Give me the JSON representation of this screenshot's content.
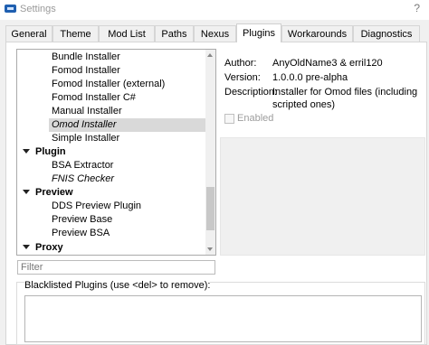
{
  "window": {
    "title": "Settings",
    "help": "?"
  },
  "tabs": [
    {
      "label": "General"
    },
    {
      "label": "Theme"
    },
    {
      "label": "Mod List"
    },
    {
      "label": "Paths"
    },
    {
      "label": "Nexus"
    },
    {
      "label": "Plugins"
    },
    {
      "label": "Workarounds"
    },
    {
      "label": "Diagnostics"
    }
  ],
  "active_tab": "Plugins",
  "tree": [
    {
      "label": "Bundle Installer"
    },
    {
      "label": "Fomod Installer"
    },
    {
      "label": "Fomod Installer (external)"
    },
    {
      "label": "Fomod Installer C#"
    },
    {
      "label": "Manual Installer"
    },
    {
      "label": "Omod Installer",
      "selected": true
    },
    {
      "label": "Simple Installer"
    },
    {
      "label": "Plugin",
      "group": true
    },
    {
      "label": "BSA Extractor"
    },
    {
      "label": "FNIS Checker"
    },
    {
      "label": "Preview",
      "group": true
    },
    {
      "label": "DDS Preview Plugin"
    },
    {
      "label": "Preview Base"
    },
    {
      "label": "Preview BSA"
    },
    {
      "label": "Proxy",
      "group": true
    }
  ],
  "filter": {
    "placeholder": "Filter",
    "value": ""
  },
  "plugin_info": {
    "author_label": "Author:",
    "author": "AnyOldName3 & erril120",
    "version_label": "Version:",
    "version": "1.0.0.0 pre-alpha",
    "description_label": "Description:",
    "description": "Installer for Omod files (including scripted ones)",
    "enabled_label": "Enabled",
    "enabled": false
  },
  "blacklist": {
    "title": "Blacklisted Plugins (use <del> to remove):"
  },
  "colors": {
    "selection": "#cce0f7",
    "accent": "#1f5fb0"
  }
}
